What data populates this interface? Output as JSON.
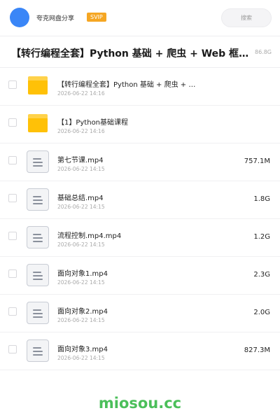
{
  "header": {
    "username": "夸克网盘分享",
    "vip_badge": "SVIP",
    "search_label": "搜索",
    "accent_color": "#3a86f7"
  },
  "share": {
    "title": "【转行编程全套】Python 基础 + 爬虫 + Web 框架…",
    "total_size": "86.8G"
  },
  "files": [
    {
      "type": "folder",
      "icon": "folder-icon",
      "name": "【转行编程全套】Python 基础 + 爬虫 + …",
      "date": "2026-06-22 14:16",
      "size": ""
    },
    {
      "type": "folder",
      "icon": "folder-icon",
      "name": "【1】Python基础课程",
      "date": "2026-06-22 14:16",
      "size": ""
    },
    {
      "type": "file",
      "icon": "document-icon",
      "name": "第七节课.mp4",
      "date": "2026-06-22 14:15",
      "size": "757.1M"
    },
    {
      "type": "file",
      "icon": "document-icon",
      "name": "基础总结.mp4",
      "date": "2026-06-22 14:15",
      "size": "1.8G"
    },
    {
      "type": "file",
      "icon": "document-icon",
      "name": "流程控制.mp4.mp4",
      "date": "2026-06-22 14:15",
      "size": "1.2G"
    },
    {
      "type": "file",
      "icon": "document-icon",
      "name": "面向对象1.mp4",
      "date": "2026-06-22 14:15",
      "size": "2.3G"
    },
    {
      "type": "file",
      "icon": "document-icon",
      "name": "面向对象2.mp4",
      "date": "2026-06-22 14:15",
      "size": "2.0G"
    },
    {
      "type": "file",
      "icon": "document-icon",
      "name": "面向对象3.mp4",
      "date": "2026-06-22 14:15",
      "size": "827.3M"
    }
  ],
  "footer": {
    "watermark": "miosou.cc",
    "watermark_color": "#4bbf5a"
  }
}
